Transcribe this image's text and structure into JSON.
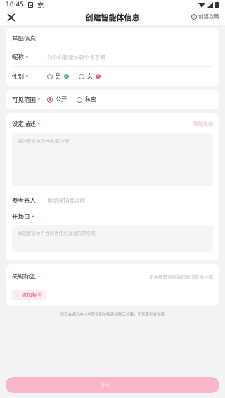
{
  "status_bar": {
    "time": "10:45",
    "app_glyph": "宠"
  },
  "nav": {
    "title": "创建智能体信息",
    "guide_label": "创建攻略"
  },
  "basic": {
    "heading": "基础信息",
    "nickname_label": "昵称",
    "nickname_placeholder": "为你的智能体取个名字吧",
    "gender_label": "性别",
    "gender_options": [
      "男",
      "女"
    ],
    "gender_selected": ""
  },
  "visibility": {
    "label": "可见范围",
    "options": [
      "公开",
      "私密"
    ],
    "selected": "公开"
  },
  "settings": {
    "description_label": "设定描述",
    "ai_generate_label": "智能生成",
    "description_placeholder": "描述智能体的性格/职业等",
    "reference_label": "参考名人",
    "reference_placeholder": "你觉得TA像谁呢",
    "opening_label": "开场白",
    "opening_placeholder": "体现智能体个性的话作为对话的开场吧"
  },
  "tags": {
    "label": "关键标签",
    "hint": "添加标签可给我们更懂智能体哦",
    "add_label": "+ 添加标签"
  },
  "footnote": "设定会通过AI技术直接影响智能体聊天效果，不代表平台立场",
  "bottom": {
    "left_text": "",
    "button_label": "提交"
  },
  "colors": {
    "accent": "#e8517b",
    "accent_light": "#f8b6c8",
    "background": "#f3f3f6"
  },
  "icons": {
    "close": "close-icon",
    "info": "info-icon",
    "male": "male-icon",
    "female": "female-icon"
  }
}
